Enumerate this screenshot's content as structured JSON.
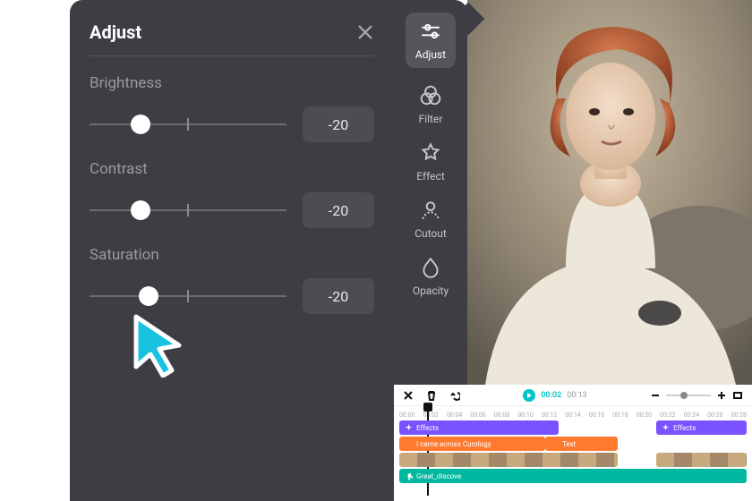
{
  "panel": {
    "title": "Adjust",
    "controls": [
      {
        "label": "Brightness",
        "value": "-20",
        "thumb_pct": 26
      },
      {
        "label": "Contrast",
        "value": "-20",
        "thumb_pct": 26
      },
      {
        "label": "Saturation",
        "value": "-20",
        "thumb_pct": 30
      }
    ]
  },
  "rail": {
    "items": [
      {
        "label": "Adjust",
        "icon": "sliders",
        "active": true
      },
      {
        "label": "Filter",
        "icon": "venn"
      },
      {
        "label": "Effect",
        "icon": "star-sparkle"
      },
      {
        "label": "Cutout",
        "icon": "person-cutout"
      },
      {
        "label": "Opacity",
        "icon": "droplet"
      }
    ]
  },
  "timeline": {
    "current": "00:02",
    "duration": "00:13",
    "ticks": [
      "00:00",
      "00:02",
      "00:04",
      "00:06",
      "00:08",
      "00:10",
      "00:12",
      "00:14",
      "00:16",
      "00:18",
      "00:20",
      "00:22",
      "00:24",
      "00:26",
      "00:28"
    ],
    "playhead_pct": 8,
    "tracks": {
      "effects1": {
        "label": "Effects",
        "left_pct": 0,
        "width_pct": 46
      },
      "effects2": {
        "label": "Effects",
        "left_pct": 74,
        "width_pct": 26
      },
      "text1": {
        "label": "I came across Curology",
        "left_pct": 0,
        "width_pct": 42
      },
      "text2": {
        "label": "Text",
        "left_pct": 42,
        "width_pct": 21
      },
      "video1": {
        "left_pct": 0,
        "width_pct": 63
      },
      "video2": {
        "left_pct": 74,
        "width_pct": 26
      },
      "audio": {
        "label": "Great_discove",
        "left_pct": 0,
        "width_pct": 100
      }
    }
  }
}
